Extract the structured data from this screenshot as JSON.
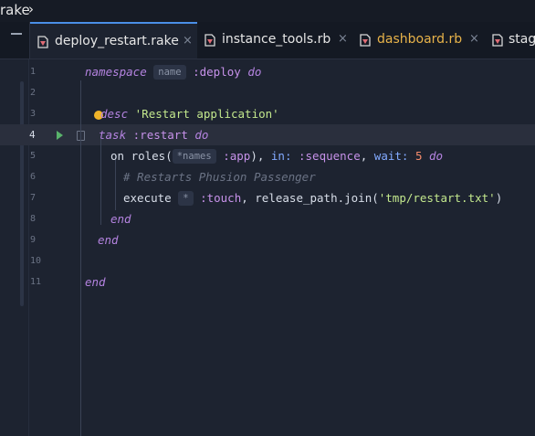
{
  "breadcrumb": {
    "text": "rake",
    "chevron": "›"
  },
  "tabs": [
    {
      "label": "deploy_restart.rake",
      "icon": "ruby-file-icon",
      "color": "#e6e6e6",
      "active": true,
      "close": "×"
    },
    {
      "label": "instance_tools.rb",
      "icon": "ruby-file-icon",
      "color": "#e6e6e6",
      "active": false,
      "close": "×"
    },
    {
      "label": "dashboard.rb",
      "icon": "ruby-file-icon",
      "color": "#e8b34a",
      "active": false,
      "close": "×"
    },
    {
      "label": "stag",
      "icon": "ruby-file-icon",
      "color": "#e6e6e6",
      "active": false,
      "close": ""
    }
  ],
  "lines": [
    {
      "num": "1"
    },
    {
      "num": "2"
    },
    {
      "num": "3"
    },
    {
      "num": "4"
    },
    {
      "num": "5"
    },
    {
      "num": "6"
    },
    {
      "num": "7"
    },
    {
      "num": "8"
    },
    {
      "num": "9"
    },
    {
      "num": "10"
    },
    {
      "num": "11"
    }
  ],
  "code": {
    "l1": {
      "kw": "namespace",
      "hint": "name",
      "sym": ":deploy",
      "kw2": "do"
    },
    "l3": {
      "kw": "desc",
      "str": "'Restart application'"
    },
    "l4": {
      "kw": "task",
      "sym": ":restart",
      "kw2": "do"
    },
    "l5": {
      "t1": "on roles(",
      "hint": "*names",
      "sym": ":app",
      "t2": "), ",
      "sym2": "in:",
      "sym3": ":sequence",
      "t3": ", ",
      "sym4": "wait:",
      "num": "5",
      "kw": "do"
    },
    "l6": {
      "cmt": "# Restarts Phusion Passenger"
    },
    "l7": {
      "t1": "execute",
      "hint": "*",
      "sym": ":touch",
      "t2": ", release_path.join(",
      "str": "'tmp/restart.txt'",
      "t3": ")"
    },
    "l8": {
      "kw": "end"
    },
    "l9": {
      "kw": "end"
    },
    "l11": {
      "kw": "end"
    }
  },
  "colors": {
    "accent": "#4a8fe7",
    "background": "#1d2330",
    "run": "#59b36b",
    "bulb": "#f0b429"
  }
}
